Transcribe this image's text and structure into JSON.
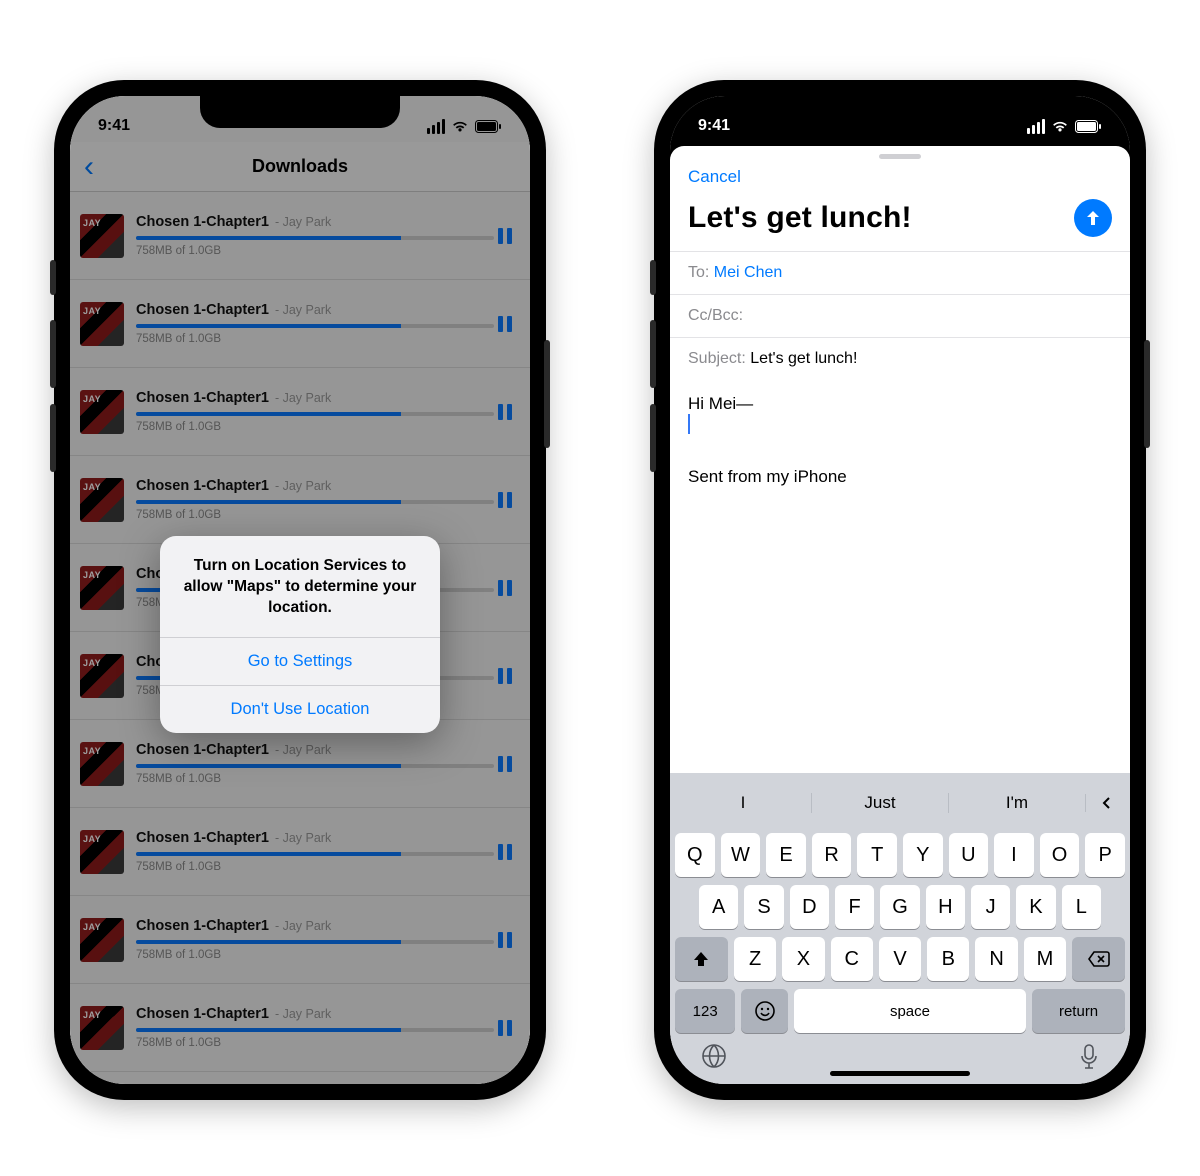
{
  "status": {
    "time": "9:41"
  },
  "left": {
    "navTitle": "Downloads",
    "item": {
      "title": "Chosen 1-Chapter1",
      "artist": "- Jay Park",
      "progressText": "758MB of 1.0GB"
    },
    "alert": {
      "message": "Turn on Location Services to allow \"Maps\" to determine your location.",
      "primary": "Go to Settings",
      "secondary": "Don't Use Location"
    }
  },
  "right": {
    "cancel": "Cancel",
    "title": "Let's get lunch!",
    "toLabel": "To:",
    "toValue": "Mei Chen",
    "ccLabel": "Cc/Bcc:",
    "subjLabel": "Subject:",
    "subjValue": "Let's get lunch!",
    "bodyGreeting": "Hi Mei—",
    "signature": "Sent from my iPhone",
    "suggestions": [
      "I",
      "Just",
      "I'm"
    ],
    "rows": {
      "r1": [
        "Q",
        "W",
        "E",
        "R",
        "T",
        "Y",
        "U",
        "I",
        "O",
        "P"
      ],
      "r2": [
        "A",
        "S",
        "D",
        "F",
        "G",
        "H",
        "J",
        "K",
        "L"
      ],
      "r3": [
        "Z",
        "X",
        "C",
        "V",
        "B",
        "N",
        "M"
      ]
    },
    "numKey": "123",
    "spaceKey": "space",
    "returnKey": "return"
  }
}
